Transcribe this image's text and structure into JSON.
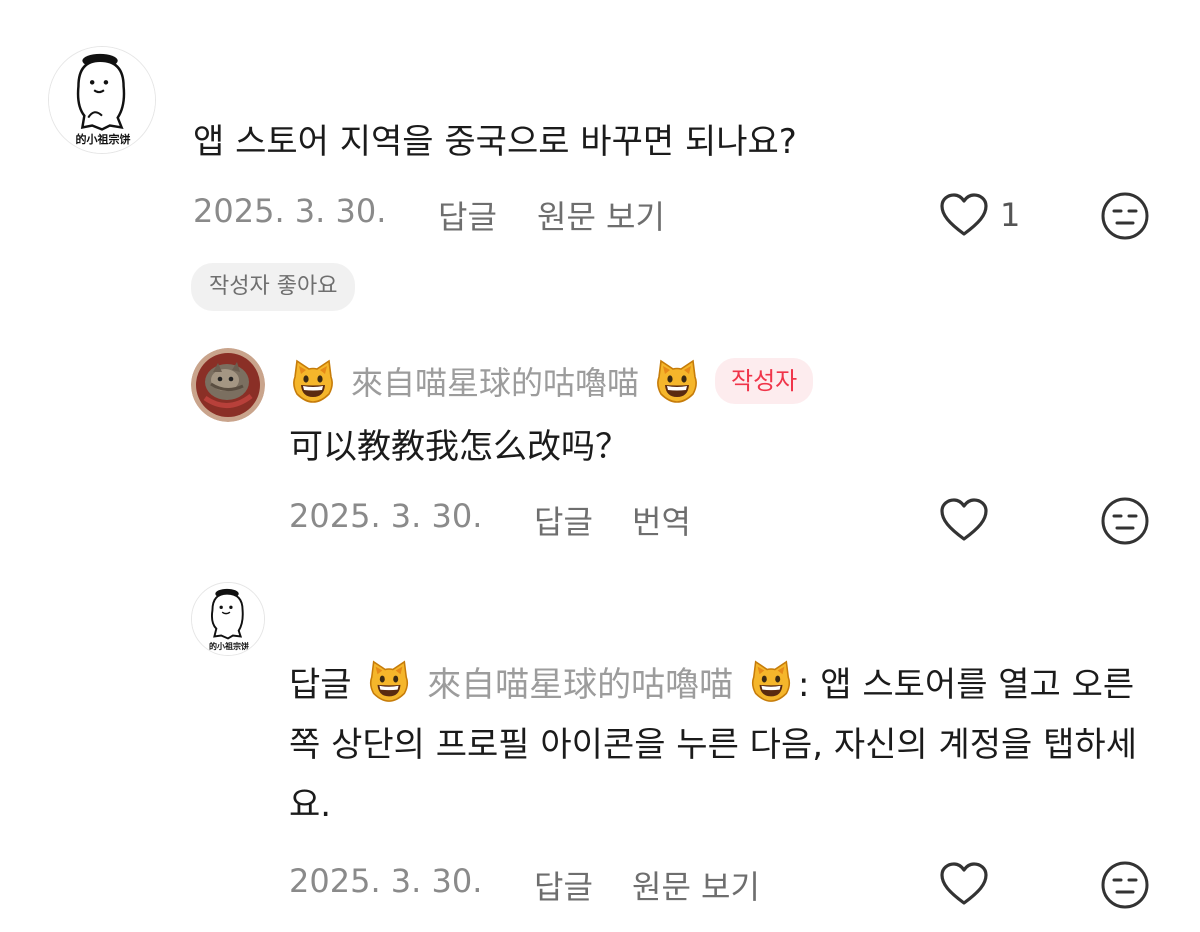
{
  "comments": [
    {
      "avatar_label": "的小祖宗饼",
      "text": "앱 스토어 지역을 중국으로 바꾸면 되나요?",
      "date": "2025. 3. 30.",
      "reply_label": "답글",
      "action_label": "원문 보기",
      "likes": "1",
      "author_liked_label": "작성자 좋아요"
    },
    {
      "username": "來自喵星球的咕嚕喵",
      "author_badge": "작성자",
      "text": "可以教教我怎么改吗？",
      "date": "2025. 3. 30.",
      "reply_label": "답글",
      "action_label": "번역"
    },
    {
      "avatar_label": "的小祖宗饼",
      "reply_prefix": "답글",
      "mention": "來自喵星球的咕嚕喵",
      "text": ": 앱 스토어를 열고 오른쪽 상단의 프로필 아이콘을 누른 다음, 자신의 계정을 탭하세요.",
      "date": "2025. 3. 30.",
      "reply_label": "답글",
      "action_label": "원문 보기"
    }
  ],
  "icons": {
    "like": "heart-outline-icon",
    "reaction": "neutral-face-icon",
    "cat_emoji": "grinning-cat-emoji"
  }
}
